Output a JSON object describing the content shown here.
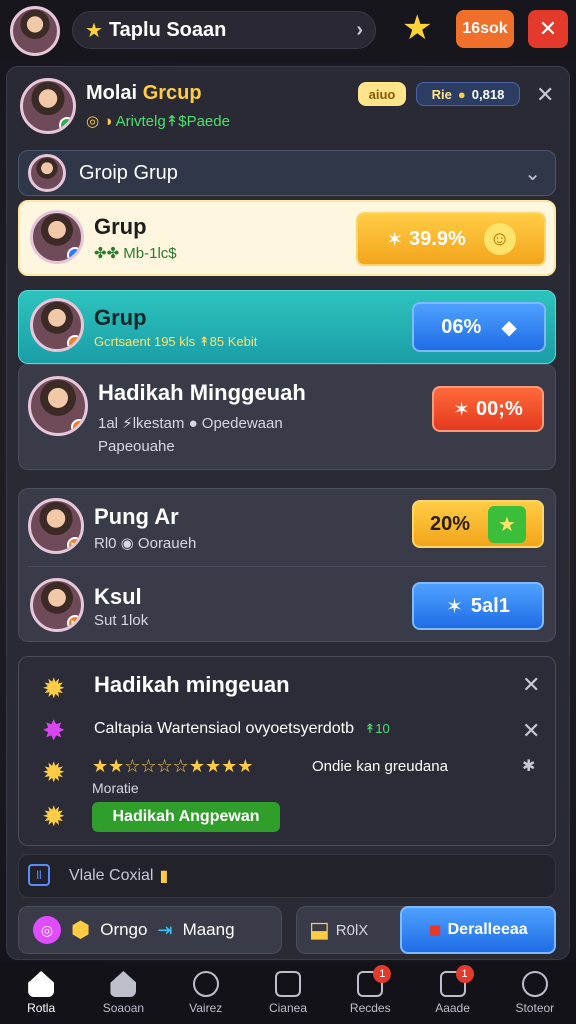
{
  "topbar": {
    "search_label": "Taplu Soaan",
    "star_icon": "star-icon",
    "coins_label": "16sok",
    "close_label": "✕"
  },
  "header": {
    "title_part1": "Molai",
    "title_part2": "Grcup",
    "subtitle": "Arivtelg↟$Paede",
    "badge1": "aiuo",
    "badge2_label": "Rie",
    "badge2_value": "0,818"
  },
  "group_select": {
    "label": "Groip Grup"
  },
  "rows": [
    {
      "title": "Grup",
      "sub": "✤✤ Mb-1lc$",
      "button": "39.9%"
    },
    {
      "title": "Grup",
      "sub": "Gcrtsaent 195 kls ↟85 Kebit",
      "button": "06%"
    },
    {
      "title": "Hadikah Minggeuah",
      "sub1": "1al ⚡lkestam ● Opedewaan",
      "sub2": "Papeouahe",
      "button": "00;%"
    },
    {
      "title": "Pung Ar",
      "sub": "Rl0 ◉ Ooraueh",
      "button": "20%"
    },
    {
      "title": "Ksul",
      "sub": "Sut 1lok",
      "button": "5al1"
    }
  ],
  "achievements": {
    "title": "Hadikah mingeuan",
    "line1": "Caltapia Wartensiaol ovyoetsyerdotb",
    "line1_extra": "↟10",
    "stars": "★★☆☆☆☆★★★★",
    "line2": "Ondie kan greudana",
    "line3": "Moratie",
    "green_label": "Hadikah Angpewan"
  },
  "footer": {
    "toggle_label": "Vlale Coxial",
    "left_btn1": "Orngo",
    "left_btn2": "Maang",
    "right_btn1": "R0lX",
    "right_btn2": "Deralleeaa"
  },
  "nav": [
    {
      "label": "Rotla",
      "icon": "home-icon"
    },
    {
      "label": "Soaoan",
      "icon": "house-icon"
    },
    {
      "label": "Vairez",
      "icon": "search-icon"
    },
    {
      "label": "Cianea",
      "icon": "square-icon"
    },
    {
      "label": "Recdes",
      "icon": "gift-icon",
      "notif": "1"
    },
    {
      "label": "Aaade",
      "icon": "shop-icon",
      "notif": "1"
    },
    {
      "label": "Stoteor",
      "icon": "profile-icon"
    }
  ],
  "colors": {
    "accent_orange": "#f3a51c",
    "accent_blue": "#1f6de6",
    "accent_red": "#e43a1f",
    "accent_green": "#2f9e2a",
    "panel": "#2a2a34"
  }
}
